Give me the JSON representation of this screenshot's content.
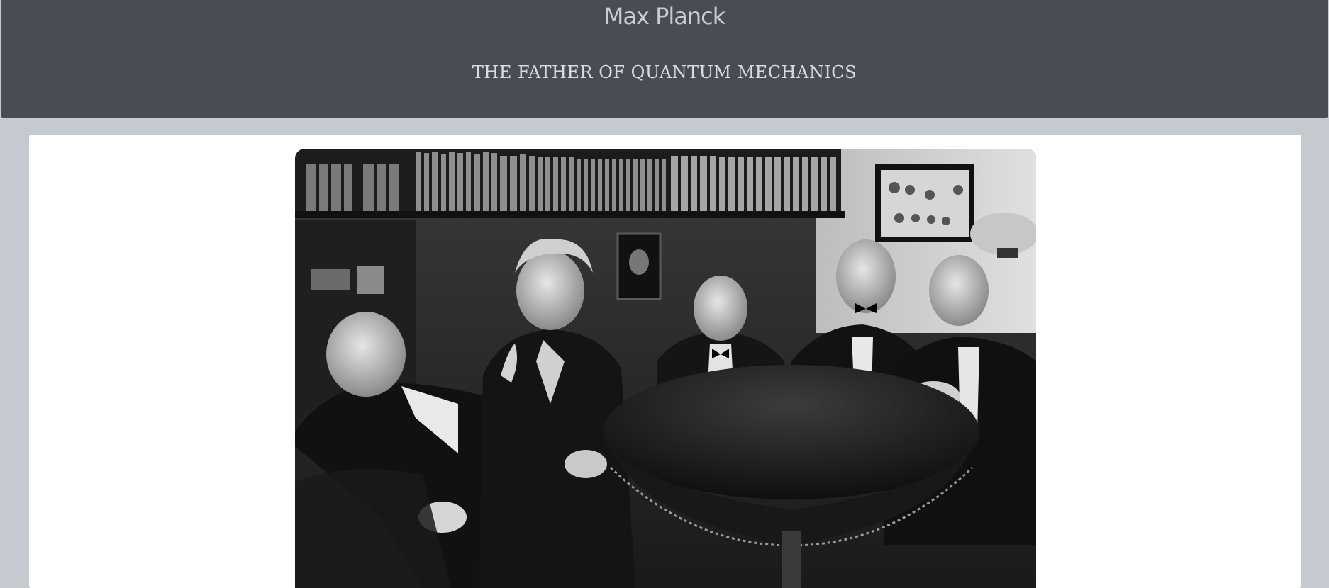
{
  "header": {
    "title": "Max Planck",
    "subtitle": "THE FATHER OF QUANTUM MECHANICS"
  },
  "main": {
    "image": {
      "alt": "Black and white photograph of five men in suits seated around a wooden table in a library"
    }
  },
  "colors": {
    "header_bg": "#494b55",
    "page_bg": "#c5cad1",
    "card_bg": "#ffffff",
    "title_color": "#c9ccd6",
    "subtitle_color": "#d9dbe2"
  }
}
